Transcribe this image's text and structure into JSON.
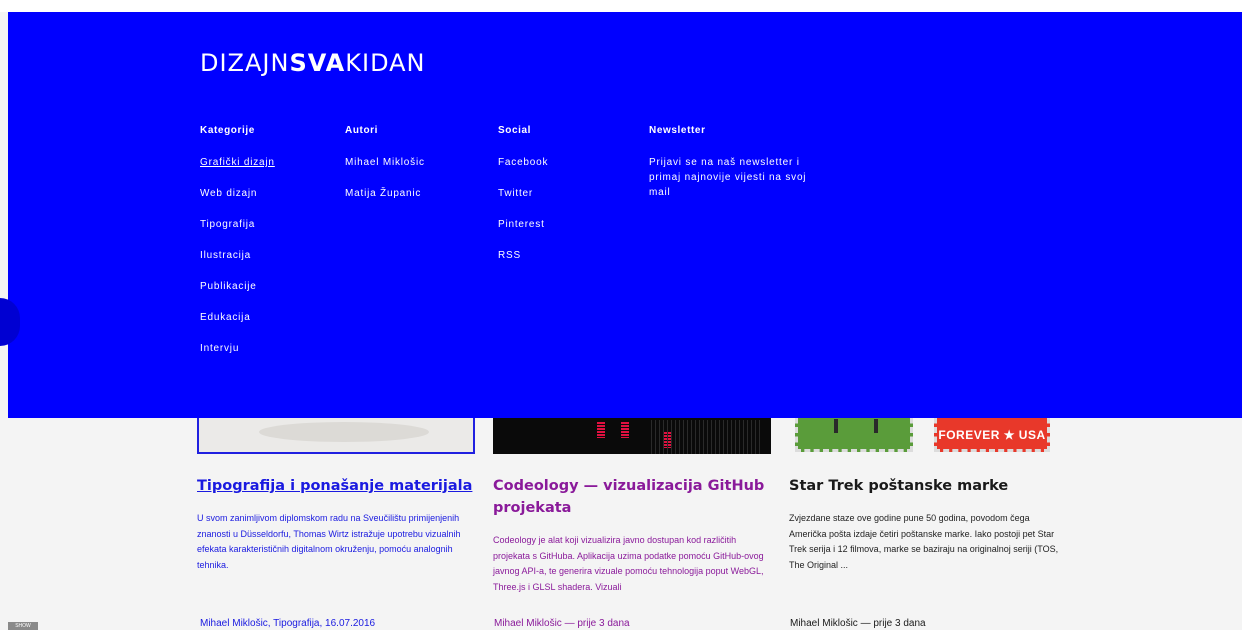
{
  "logo": {
    "light_part": "DIZAJN",
    "bold_part": "SVA",
    "light_part_2": "KIDAN"
  },
  "menu": {
    "columns": [
      {
        "heading": "Kategorije",
        "items": [
          "Grafički dizajn",
          "Web dizajn",
          "Tipografija",
          "Ilustracija",
          "Publikacije",
          "Edukacija",
          "Intervju"
        ]
      },
      {
        "heading": "Autori",
        "items": [
          "Mihael Miklošic",
          "Matija Županic"
        ]
      },
      {
        "heading": "Social",
        "items": [
          "Facebook",
          "Twitter",
          "Pinterest",
          "RSS"
        ]
      }
    ],
    "newsletter": {
      "heading": "Newsletter",
      "text": "Prijavi se na naš newsletter i primaj najnovije vijesti na svoj mail"
    }
  },
  "articles": [
    {
      "title": "Tipografija i ponašanje materijala",
      "excerpt": "U svom zanimljivom diplomskom radu na Sveučilištu primijenjenih znanosti u Düsseldorfu, Thomas Wirtz istražuje upotrebu vizualnih efekata karakterističnih digitalnom okruženju, pomoću analognih tehnika.",
      "meta": "Mihael Miklošic, Tipografija, 16.07.2016"
    },
    {
      "title": "Codeology — vizualizacija GitHub projekata",
      "excerpt": "Codeology je alat koji vizualizira javno dostupan kod različitih projekata s GitHuba. Aplikacija uzima podatke pomoću GitHub-ovog javnog API-a, te generira vizuale pomoću tehnologija poput WebGL, Three.js i GLSL shadera. Vizuali",
      "meta": "Mihael Miklošic — prije 3 dana"
    },
    {
      "title": "Star Trek poštanske marke",
      "excerpt": "Zvjezdane staze ove godine pune 50 godina, povodom čega Američka pošta izdaje četiri poštanske marke. Iako postoji pet Star Trek serija i 12 filmova, marke se baziraju na originalnoj seriji (TOS, The Original ...",
      "meta": "Mihael Miklošic — prije 3 dana",
      "stamp_text": "FOREVER ★ USA"
    }
  ],
  "show_badge": "SHOW",
  "colors": {
    "menu_bg": "#0000ff",
    "link_blue": "#1a1ae0",
    "visited_purple": "#8a1a9a",
    "page_bg": "#f4f4f4"
  }
}
